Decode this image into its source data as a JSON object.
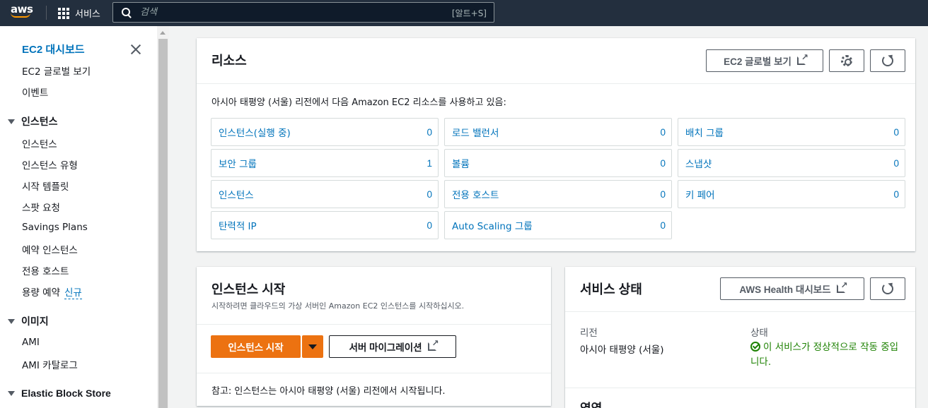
{
  "topnav": {
    "logo_text": "aws",
    "services_label": "서비스",
    "search_placeholder": "검색",
    "search_shortcut": "[알트+S]"
  },
  "sidebar": {
    "items": [
      {
        "label": "EC2 대시보드",
        "active": true
      },
      {
        "label": "EC2 글로벌 보기"
      },
      {
        "label": "이벤트"
      }
    ],
    "sections": [
      {
        "title": "인스턴스",
        "items": [
          "인스턴스",
          "인스턴스 유형",
          "시작 템플릿",
          "스팟 요청",
          "Savings Plans",
          "예약 인스턴스",
          "전용 호스트",
          "용량 예약"
        ]
      },
      {
        "title": "이미지",
        "items": [
          "AMI",
          "AMI 카탈로그"
        ]
      },
      {
        "title": "Elastic Block Store",
        "items": []
      }
    ],
    "new_badge": "신규"
  },
  "resources": {
    "title": "리소스",
    "global_view_button": "EC2 글로벌 보기",
    "description": "아시아 태평양 (서울) 리전에서 다음 Amazon EC2 리소스를 사용하고 있음:",
    "tiles": [
      {
        "label": "인스턴스(실행 중)",
        "count": "0"
      },
      {
        "label": "로드 밸런서",
        "count": "0"
      },
      {
        "label": "배치 그룹",
        "count": "0"
      },
      {
        "label": "보안 그룹",
        "count": "1"
      },
      {
        "label": "볼륨",
        "count": "0"
      },
      {
        "label": "스냅샷",
        "count": "0"
      },
      {
        "label": "인스턴스",
        "count": "0"
      },
      {
        "label": "전용 호스트",
        "count": "0"
      },
      {
        "label": "키 페어",
        "count": "0"
      },
      {
        "label": "탄력적 IP",
        "count": "0"
      },
      {
        "label": "Auto Scaling 그룹",
        "count": "0"
      }
    ]
  },
  "launch": {
    "title": "인스턴스 시작",
    "description": "시작하려면 클라우드의 가상 서버인 Amazon EC2 인스턴스를 시작하십시오.",
    "launch_button": "인스턴스 시작",
    "migrate_button": "서버 마이그레이션",
    "note": "참고: 인스턴스는 아시아 태평양 (서울) 리전에서 시작됩니다."
  },
  "service_health": {
    "title": "서비스 상태",
    "health_button": "AWS Health 대시보드",
    "region_label": "리전",
    "region_value": "아시아 태평양 (서울)",
    "status_label": "상태",
    "status_value": "이 서비스가 정상적으로 작동 중입니다.",
    "next_heading": "영역"
  },
  "colors": {
    "nav_bg": "#232f3e",
    "link": "#0073bb",
    "primary": "#ec7211",
    "success": "#1d8102"
  }
}
